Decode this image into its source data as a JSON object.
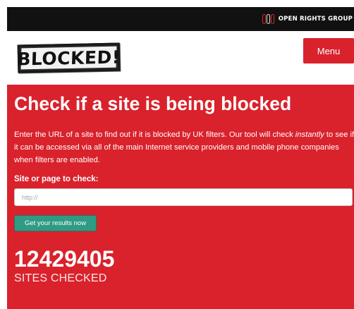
{
  "topbar": {
    "org_name": "OPEN RIGHTS GROUP",
    "org_icon": "org-logo-icon"
  },
  "header": {
    "logo_text": "BLOCKED!",
    "menu_label": "Menu"
  },
  "hero": {
    "title": "Check if a site is being blocked",
    "intro_before": "Enter the URL of a site to find out if it is blocked by UK filters. Our tool will check ",
    "intro_emphasis": "instantly",
    "intro_after": " to see if it can be accessed via all of the main Internet service providers and mobile phone companies when filters are enabled.",
    "field_label": "Site or page to check:",
    "input_value": "",
    "input_placeholder": "http://",
    "submit_label": "Get your results now",
    "sites_count": "12429405",
    "sites_label": "SITES CHECKED"
  },
  "colors": {
    "brand_red": "#d9222c",
    "topbar_black": "#111111",
    "button_teal": "#2f9b84"
  }
}
